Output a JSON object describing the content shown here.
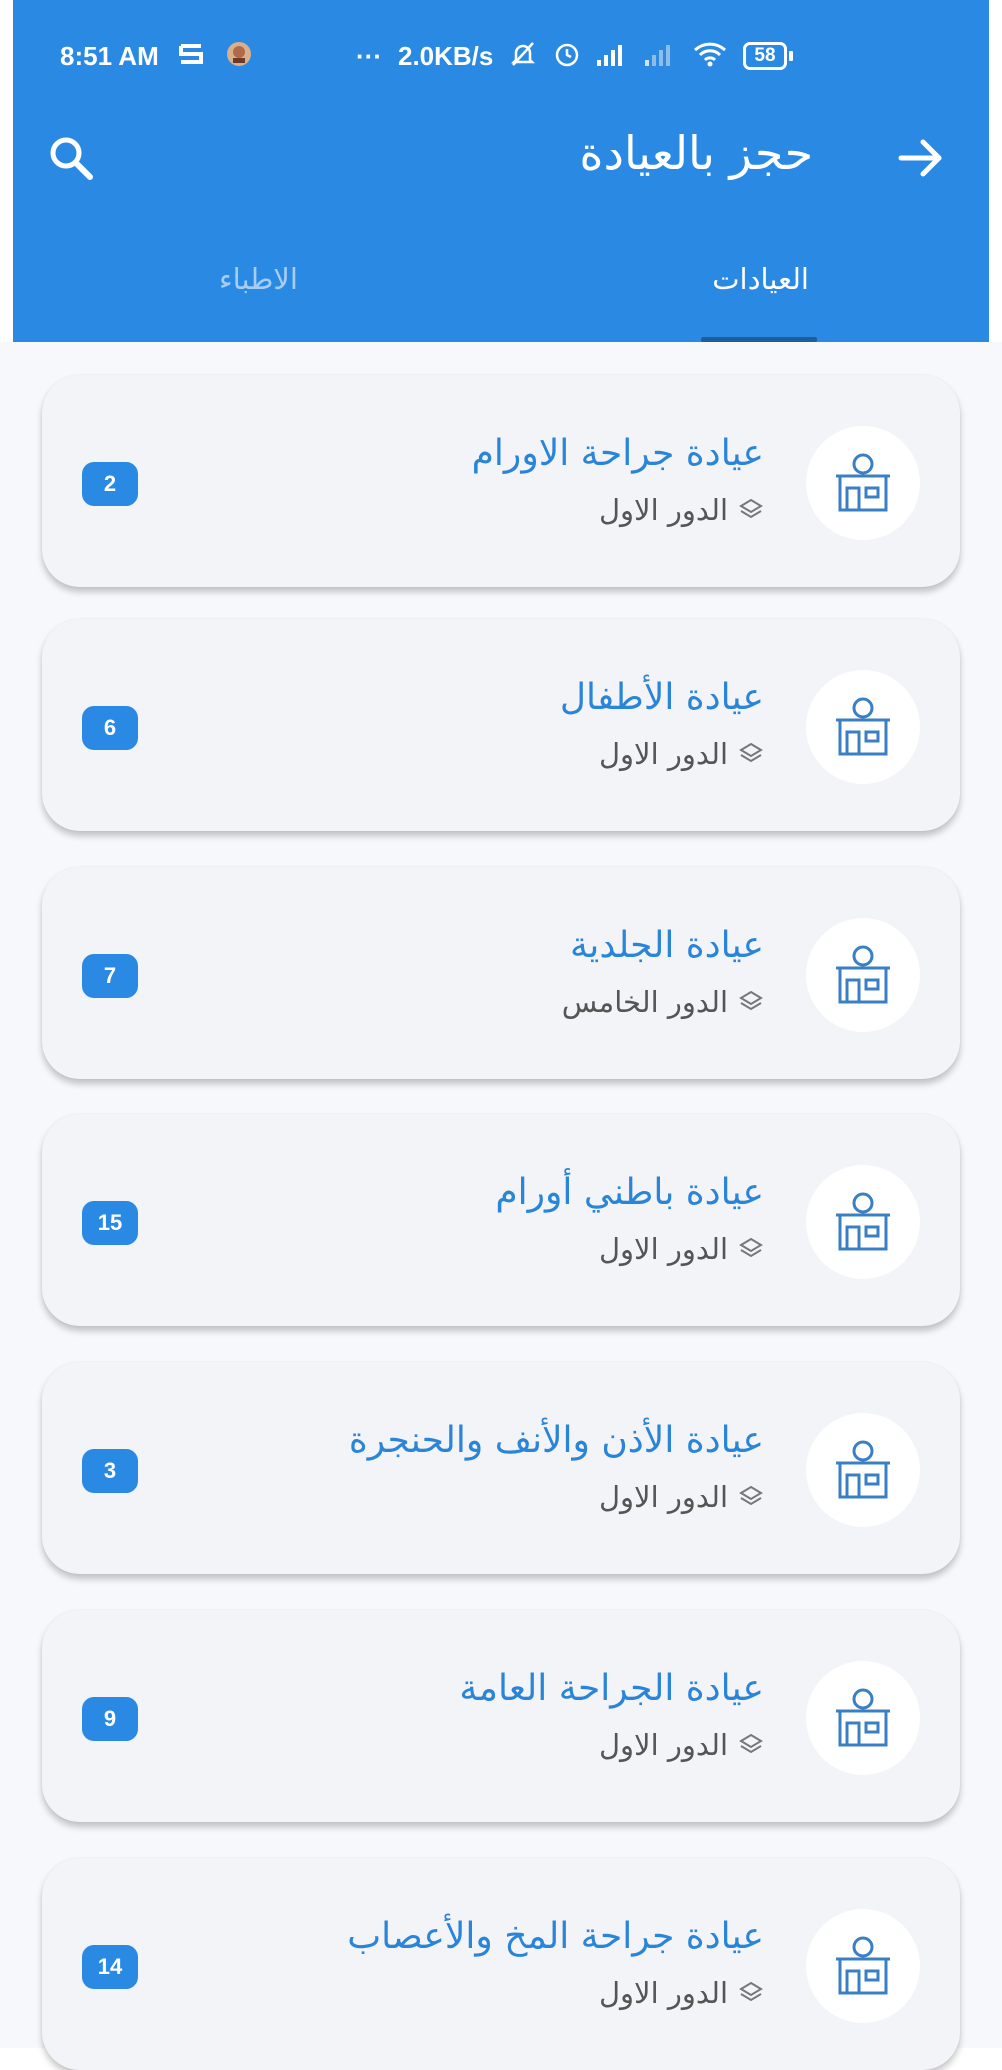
{
  "status_bar": {
    "time": "8:51 AM",
    "dots": "···",
    "net_speed": "2.0KB/s",
    "battery": "58"
  },
  "header": {
    "title": "حجز بالعيادة",
    "back_icon": "arrow-right-icon",
    "search_icon": "search-icon"
  },
  "tabs": [
    {
      "label": "العيادات",
      "active": true
    },
    {
      "label": "الاطباء",
      "active": false
    }
  ],
  "clinics": [
    {
      "name": "عيادة جراحة الاورام",
      "floor": "الدور الاول",
      "count": "2"
    },
    {
      "name": "عيادة الأطفال",
      "floor": "الدور الاول",
      "count": "6"
    },
    {
      "name": "عيادة الجلدية",
      "floor": "الدور الخامس",
      "count": "7"
    },
    {
      "name": "عيادة باطني أورام",
      "floor": "الدور الاول",
      "count": "15"
    },
    {
      "name": "عيادة الأذن والأنف والحنجرة",
      "floor": "الدور الاول",
      "count": "3"
    },
    {
      "name": "عيادة الجراحة العامة",
      "floor": "الدور الاول",
      "count": "9"
    },
    {
      "name": "عيادة جراحة المخ والأعصاب",
      "floor": "الدور الاول",
      "count": "14"
    }
  ],
  "colors": {
    "primary": "#2a8ae3",
    "clinic_name": "#2a85d8",
    "tab_indicator": "#1c5f9f"
  }
}
